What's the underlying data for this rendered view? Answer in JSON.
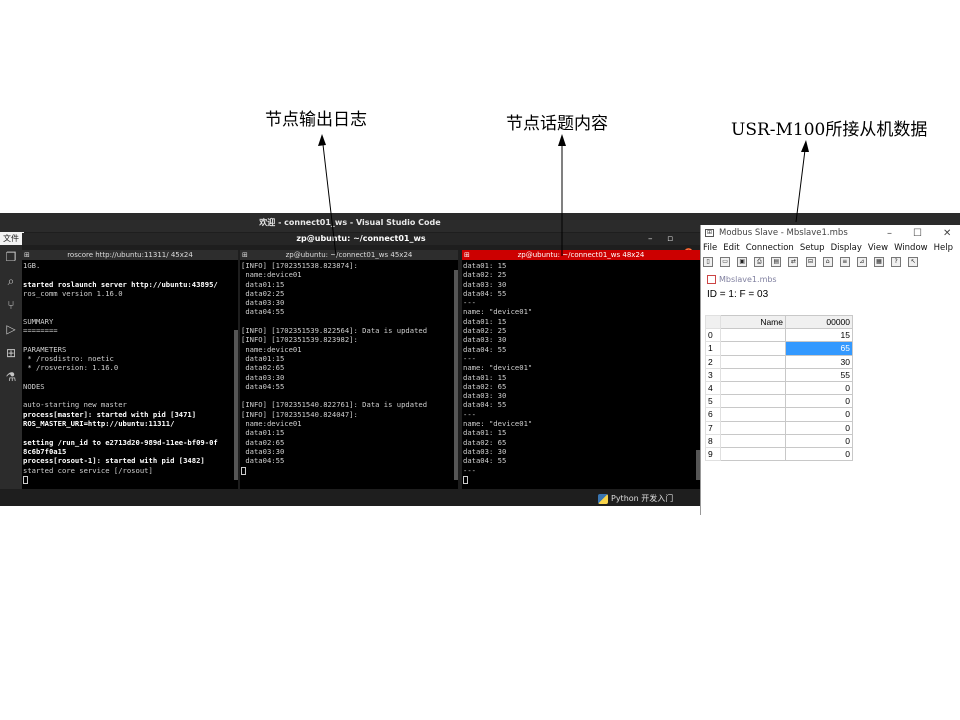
{
  "annotations": {
    "log": "节点输出日志",
    "topic": "节点话题内容",
    "modbus": "USR-M100所接从机数据"
  },
  "vscode": {
    "title": "欢迎 - connect01_ws - Visual Studio Code",
    "menu_file": "文件",
    "status_python": "Python 开发入门"
  },
  "terminal": {
    "title": "zp@ubuntu: ~/connect01_ws",
    "panes": [
      {
        "title": "roscore http://ubuntu:11311/ 45x24",
        "lines": [
          "1GB.",
          "",
          "started roslaunch server http://ubuntu:43895/",
          "ros_comm version 1.16.0",
          "",
          "",
          "SUMMARY",
          "========",
          "",
          "PARAMETERS",
          " * /rosdistro: noetic",
          " * /rosversion: 1.16.0",
          "",
          "NODES",
          "",
          "auto-starting new master",
          "process[master]: started with pid [3471]",
          "ROS_MASTER_URI=http://ubuntu:11311/",
          "",
          "setting /run_id to e2713d20-989d-11ee-bf09-0f",
          "8c6b7f0a15",
          "process[rosout-1]: started with pid [3482]",
          "started core service [/rosout]"
        ],
        "bold_lines": [
          2,
          16,
          17,
          19,
          20,
          21
        ]
      },
      {
        "title": "zp@ubuntu: ~/connect01_ws 45x24",
        "lines": [
          "[INFO] [1702351538.823874]:",
          " name:device01",
          " data01:15",
          " data02:25",
          " data03:30",
          " data04:55",
          "",
          "[INFO] [1702351539.822564]: Data is updated",
          "[INFO] [1702351539.823982]:",
          " name:device01",
          " data01:15",
          " data02:65",
          " data03:30",
          " data04:55",
          "",
          "[INFO] [1702351540.822761]: Data is updated",
          "[INFO] [1702351540.824047]:",
          " name:device01",
          " data01:15",
          " data02:65",
          " data03:30",
          " data04:55"
        ],
        "bold_lines": []
      },
      {
        "title": "zp@ubuntu: ~/connect01_ws 48x24",
        "lines": [
          "data01: 15",
          "data02: 25",
          "data03: 30",
          "data04: 55",
          "---",
          "name: \"device01\"",
          "data01: 15",
          "data02: 25",
          "data03: 30",
          "data04: 55",
          "---",
          "name: \"device01\"",
          "data01: 15",
          "data02: 65",
          "data03: 30",
          "data04: 55",
          "---",
          "name: \"device01\"",
          "data01: 15",
          "data02: 65",
          "data03: 30",
          "data04: 55",
          "---"
        ],
        "bold_lines": []
      }
    ]
  },
  "modbus": {
    "title": "Modbus Slave - Mbslave1.mbs",
    "menu": [
      "File",
      "Edit",
      "Connection",
      "Setup",
      "Display",
      "View",
      "Window",
      "Help"
    ],
    "doc_title": "Mbslave1.mbs",
    "id_line": "ID = 1: F = 03",
    "header": {
      "name": "Name",
      "value": "00000"
    },
    "rows": [
      {
        "idx": "0",
        "name": "",
        "value": "15"
      },
      {
        "idx": "1",
        "name": "",
        "value": "65"
      },
      {
        "idx": "2",
        "name": "",
        "value": "30"
      },
      {
        "idx": "3",
        "name": "",
        "value": "55"
      },
      {
        "idx": "4",
        "name": "",
        "value": "0"
      },
      {
        "idx": "5",
        "name": "",
        "value": "0"
      },
      {
        "idx": "6",
        "name": "",
        "value": "0"
      },
      {
        "idx": "7",
        "name": "",
        "value": "0"
      },
      {
        "idx": "8",
        "name": "",
        "value": "0"
      },
      {
        "idx": "9",
        "name": "",
        "value": "0"
      }
    ],
    "selected_row": 1
  }
}
